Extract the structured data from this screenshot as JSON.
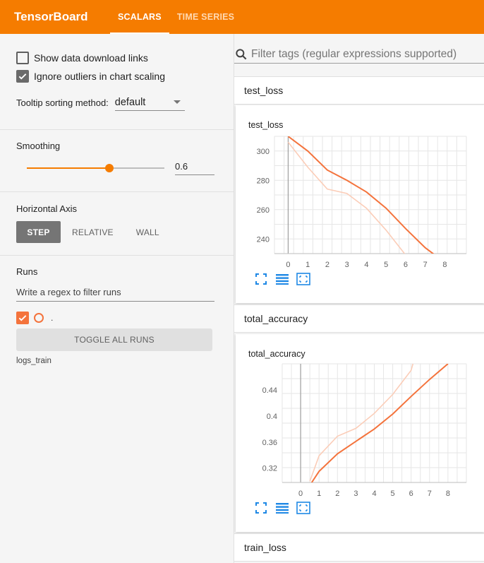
{
  "header": {
    "brand": "TensorBoard",
    "tabs": [
      {
        "label": "SCALARS",
        "active": true
      },
      {
        "label": "TIME SERIES",
        "active": false
      }
    ]
  },
  "sidebar": {
    "show_download_links": {
      "label": "Show data download links",
      "checked": false
    },
    "ignore_outliers": {
      "label": "Ignore outliers in chart scaling",
      "checked": true
    },
    "tooltip_sort": {
      "label": "Tooltip sorting method:",
      "value": "default"
    },
    "smoothing": {
      "title": "Smoothing",
      "value": "0.6",
      "fraction": 0.6
    },
    "horizontal_axis": {
      "title": "Horizontal Axis",
      "options": [
        "STEP",
        "RELATIVE",
        "WALL"
      ],
      "selected": "STEP"
    },
    "runs": {
      "title": "Runs",
      "filter_placeholder": "Write a regex to filter runs",
      "run_name": ".",
      "toggle_label": "TOGGLE ALL RUNS",
      "log_dir": "logs_train"
    }
  },
  "main": {
    "search_placeholder": "Filter tags (regular expressions supported)",
    "groups": [
      {
        "name": "test_loss"
      },
      {
        "name": "total_accuracy"
      },
      {
        "name": "train_loss"
      }
    ]
  },
  "colors": {
    "accent": "#f57c00",
    "series": "#f4733c",
    "series_raw": "#fbcdb8",
    "icon_blue": "#1e88e5"
  },
  "icons": [
    "search-icon",
    "fit-domain-icon",
    "data-table-icon",
    "zoom-selection-icon",
    "check-icon"
  ],
  "chart_data": [
    {
      "type": "line",
      "title": "test_loss",
      "xlabel": "",
      "ylabel": "",
      "xlim": [
        -0.7,
        9.1
      ],
      "ylim": [
        230,
        310
      ],
      "x_ticks": [
        0,
        1,
        2,
        3,
        4,
        5,
        6,
        7,
        8
      ],
      "y_ticks": [
        240,
        260,
        280,
        300
      ],
      "series": [
        {
          "x": [
            0,
            1,
            2,
            3,
            4,
            5,
            6,
            7,
            7.5
          ],
          "values": [
            310,
            300,
            287,
            280,
            272,
            261,
            247,
            234,
            229
          ]
        },
        {
          "x": [
            0,
            1,
            2,
            3,
            4,
            5,
            6
          ],
          "values": [
            306,
            289,
            274,
            271,
            261,
            246,
            229
          ]
        }
      ],
      "grid": true
    },
    {
      "type": "line",
      "title": "total_accuracy",
      "xlabel": "",
      "ylabel": "",
      "xlim": [
        -1,
        9
      ],
      "ylim": [
        0.298,
        0.48
      ],
      "x_ticks": [
        0,
        1,
        2,
        3,
        4,
        5,
        6,
        7,
        8
      ],
      "y_ticks": [
        0.32,
        0.36,
        0.4,
        0.44
      ],
      "y_tick_labels": [
        "0.32",
        "0.36",
        "0.4",
        "0.44"
      ],
      "series": [
        {
          "x": [
            0.6,
            1,
            2,
            3,
            4,
            5,
            6,
            7,
            8
          ],
          "values": [
            0.298,
            0.315,
            0.342,
            0.361,
            0.38,
            0.403,
            0.43,
            0.456,
            0.48
          ]
        },
        {
          "x": [
            0.5,
            1,
            2,
            3,
            4,
            5,
            6,
            6.1
          ],
          "values": [
            0.3,
            0.339,
            0.369,
            0.381,
            0.404,
            0.433,
            0.47,
            0.48
          ]
        }
      ],
      "grid": true
    }
  ]
}
